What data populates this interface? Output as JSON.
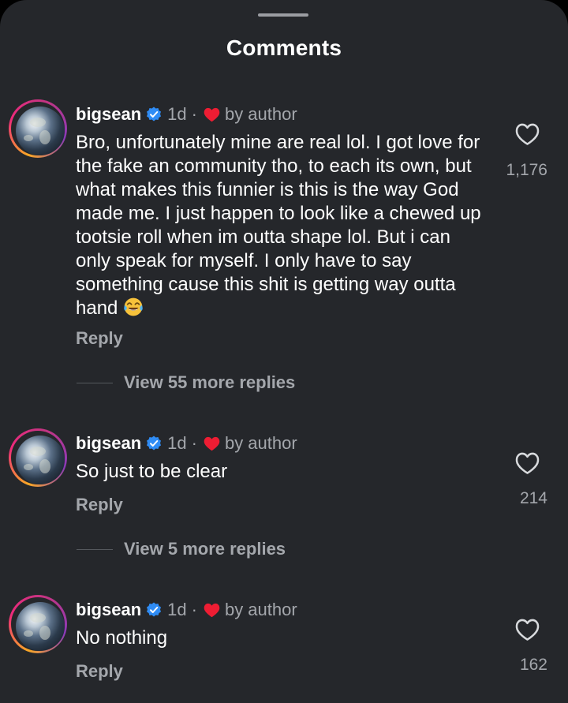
{
  "sheet": {
    "title": "Comments"
  },
  "comments": [
    {
      "username": "bigsean",
      "time": "1d",
      "separator": "·",
      "by_author": "by author",
      "text": "Bro, unfortunately mine are real lol. I got love for the fake an community tho, to each its own, but what makes this funnier is this is the way God made me. I just happen to look like a chewed up tootsie roll when im outta shape lol. But i can only speak for myself. I only have to say something cause this shit is getting way outta hand",
      "emoji": "face-with-tears-of-joy",
      "reply_label": "Reply",
      "likes": "1,176",
      "view_replies": "View 55 more replies"
    },
    {
      "username": "bigsean",
      "time": "1d",
      "separator": "·",
      "by_author": "by author",
      "text": "So just to be clear",
      "reply_label": "Reply",
      "likes": "214",
      "view_replies": "View 5 more replies"
    },
    {
      "username": "bigsean",
      "time": "1d",
      "separator": "·",
      "by_author": "by author",
      "text": "No nothing",
      "reply_label": "Reply",
      "likes": "162"
    }
  ],
  "icons": {
    "verified": "verified-badge-icon",
    "liked_by_author": "red-heart-icon",
    "like": "heart-outline-icon"
  },
  "colors": {
    "background": "#25272b",
    "verified": "#2f8cf5",
    "heart": "#ee1d33",
    "secondary_text": "#a4a7ac"
  }
}
